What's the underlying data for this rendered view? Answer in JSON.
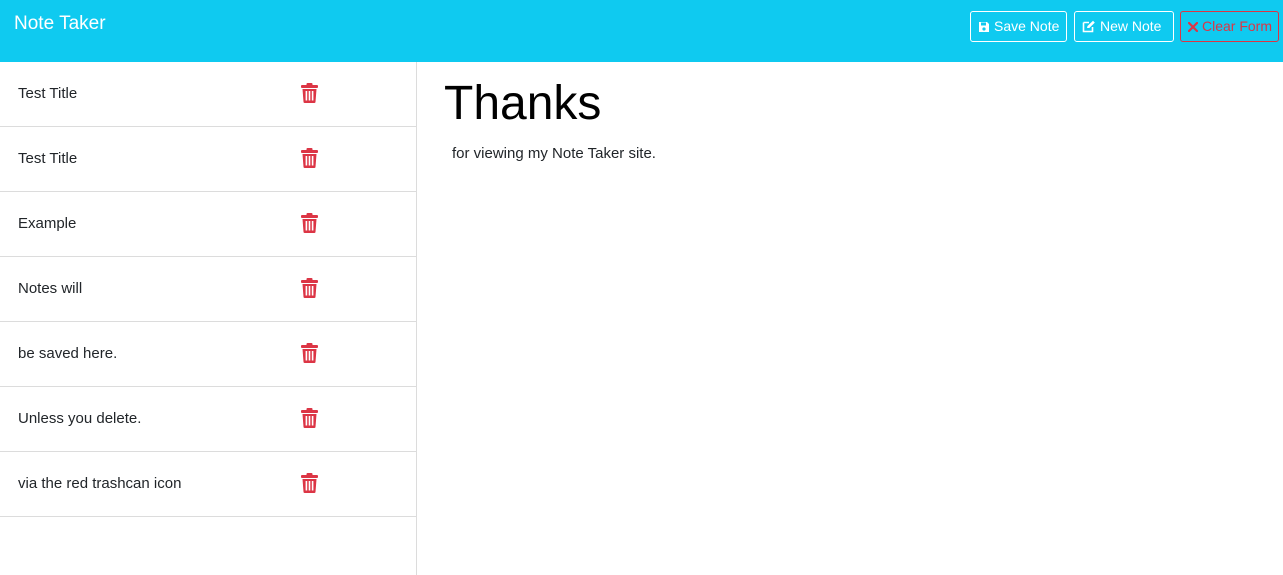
{
  "app": {
    "title": "Note Taker"
  },
  "toolbar": {
    "save_label": "Save Note",
    "save_icon": "save-icon",
    "new_label": "New Note",
    "new_icon": "edit-icon",
    "clear_label": "Clear Form",
    "clear_icon": "x-icon"
  },
  "colors": {
    "navbar": "#0fcaf0",
    "trash": "#dc3545",
    "clear_button": "#dc3545"
  },
  "notes": [
    {
      "title": "Test Title",
      "icon": "trash-icon"
    },
    {
      "title": "Test Title",
      "icon": "trash-icon"
    },
    {
      "title": "Example",
      "icon": "trash-icon"
    },
    {
      "title": "Notes will",
      "icon": "trash-icon"
    },
    {
      "title": "be saved here.",
      "icon": "trash-icon"
    },
    {
      "title": "Unless you delete.",
      "icon": "trash-icon"
    },
    {
      "title": "via the red trashcan icon",
      "icon": "trash-icon"
    }
  ],
  "active_note": {
    "title": "Thanks",
    "text": "for viewing my Note Taker site."
  }
}
